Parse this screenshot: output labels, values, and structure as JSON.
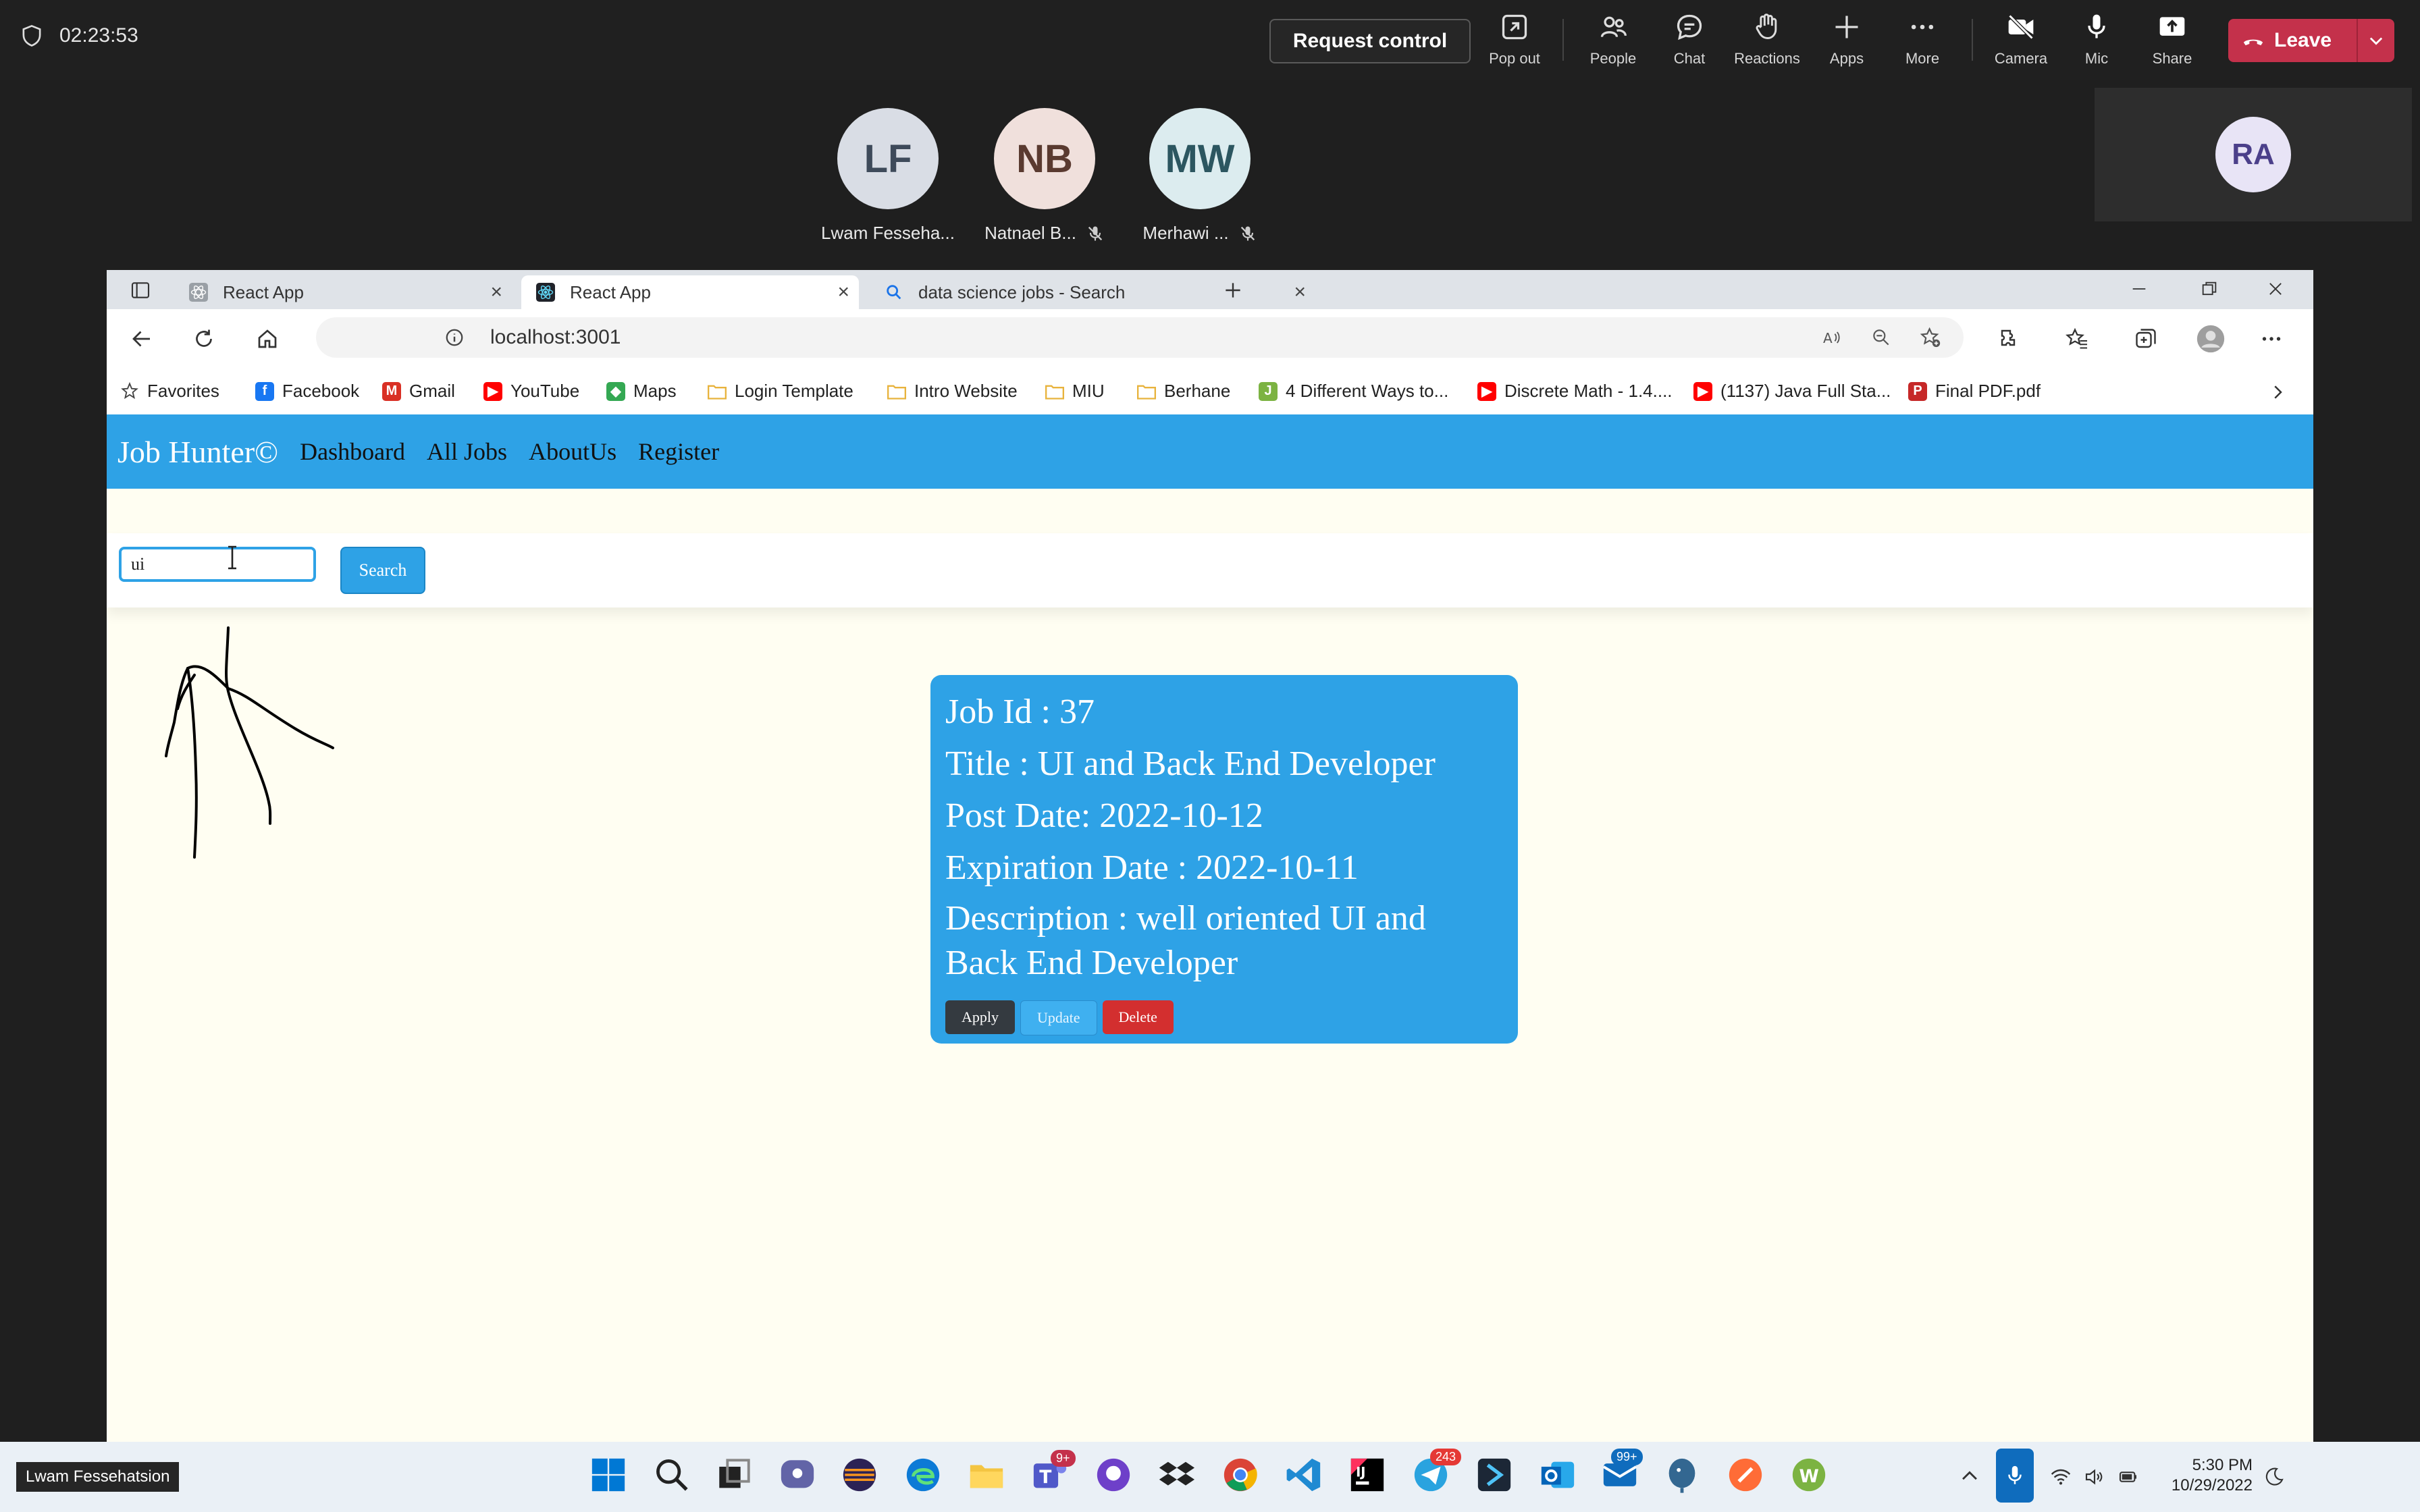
{
  "meeting": {
    "timer": "02:23:53",
    "request_control": "Request control",
    "toolbar": {
      "pop_out": "Pop out",
      "people": "People",
      "chat": "Chat",
      "reactions": "Reactions",
      "apps": "Apps",
      "more": "More",
      "camera": "Camera",
      "mic": "Mic",
      "share": "Share",
      "leave": "Leave"
    },
    "participants": [
      {
        "initials": "LF",
        "name": "Lwam Fesseha...",
        "bg": "#d9dde5",
        "fg": "#3e4a5a"
      },
      {
        "initials": "NB",
        "name": "Natnael B...",
        "bg": "#f0e0dc",
        "fg": "#5a3a30"
      },
      {
        "initials": "MW",
        "name": "Merhawi ...",
        "bg": "#dcecef",
        "fg": "#2c5660"
      }
    ],
    "self_initials": "RA",
    "presenter_name": "Lwam Fessehatsion"
  },
  "browser": {
    "tabs": [
      {
        "title": "React App"
      },
      {
        "title": "React App"
      },
      {
        "title": "data science jobs - Search"
      }
    ],
    "url": "localhost:3001",
    "favorites": [
      {
        "label": "Favorites",
        "icon": "star-icon",
        "color": "#444"
      },
      {
        "label": "Facebook",
        "icon": "facebook-icon",
        "color": "#1877f2",
        "glyph": "f"
      },
      {
        "label": "Gmail",
        "icon": "gmail-icon",
        "color": "#d93025",
        "glyph": "M"
      },
      {
        "label": "YouTube",
        "icon": "youtube-icon",
        "color": "#ff0000",
        "glyph": "▶"
      },
      {
        "label": "Maps",
        "icon": "maps-icon",
        "color": "#34a853",
        "glyph": "◆"
      },
      {
        "label": "Login Template",
        "icon": "folder-icon",
        "color": "#e8b33d"
      },
      {
        "label": "Intro Website",
        "icon": "folder-icon",
        "color": "#e8b33d"
      },
      {
        "label": "MIU",
        "icon": "folder-icon",
        "color": "#e8b33d"
      },
      {
        "label": "Berhane",
        "icon": "folder-icon",
        "color": "#e8b33d"
      },
      {
        "label": "4 Different Ways to...",
        "icon": "java-icon",
        "color": "#7cb342",
        "glyph": "J"
      },
      {
        "label": "Discrete Math - 1.4....",
        "icon": "youtube-icon",
        "color": "#ff0000",
        "glyph": "▶"
      },
      {
        "label": "(1137) Java Full Sta...",
        "icon": "youtube-icon",
        "color": "#ff0000",
        "glyph": "▶"
      },
      {
        "label": "Final PDF.pdf",
        "icon": "pdf-icon",
        "color": "#c62828",
        "glyph": "P"
      }
    ]
  },
  "app": {
    "brand": "Job Hunter©",
    "nav": [
      "Dashboard",
      "All Jobs",
      "AboutUs",
      "Register"
    ],
    "search": {
      "value": "ui",
      "button": "Search"
    },
    "job": {
      "id_line": "Job Id : 37",
      "title_line": "Title : UI and Back End Developer",
      "post_line": "Post Date: 2022-10-12",
      "exp_line": "Expiration Date : 2022-10-11",
      "desc_line": "Description : well oriented UI and Back End Developer",
      "apply": "Apply",
      "update": "Update",
      "delete": "Delete"
    }
  },
  "taskbar": {
    "time": "5:30 PM",
    "date": "10/29/2022",
    "badges": {
      "teams": "9+",
      "telegram": "243",
      "mail": "99+"
    }
  },
  "colors": {
    "app_blue": "#2ea2e6",
    "leave_red": "#c4314b",
    "delete_red": "#d32f2f",
    "apply_dark": "#343a40",
    "page_bg": "#fffef2"
  }
}
